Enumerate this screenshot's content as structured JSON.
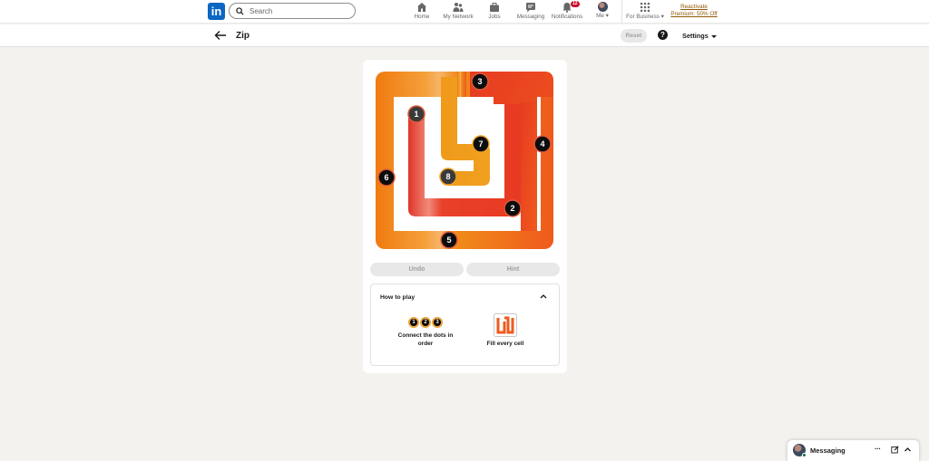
{
  "nav": {
    "logo": "in",
    "search_placeholder": "Search",
    "items": [
      {
        "label": "Home",
        "icon": "home-icon"
      },
      {
        "label": "My Network",
        "icon": "network-icon"
      },
      {
        "label": "Jobs",
        "icon": "briefcase-icon"
      },
      {
        "label": "Messaging",
        "icon": "chat-icon"
      },
      {
        "label": "Notifications",
        "icon": "bell-icon",
        "badge": "12"
      },
      {
        "label": "Me",
        "icon": "avatar"
      },
      {
        "label": "For Business",
        "icon": "grid-icon"
      }
    ],
    "premium": "Reactivate Premium: 50% Off"
  },
  "game": {
    "title": "Zip",
    "reset_label": "Reset",
    "help_label": "?",
    "settings_label": "Settings",
    "numbers": [
      "1",
      "2",
      "3",
      "4",
      "5",
      "6",
      "7",
      "8"
    ],
    "undo_label": "Undo",
    "hint_label": "Hint",
    "colors": {
      "path_light": "#f59e0b",
      "path_mid": "#ea580c",
      "path_dark": "#dc2626"
    }
  },
  "howto": {
    "title": "How to play",
    "step1_dots": [
      "1",
      "2",
      "3"
    ],
    "step1_text": "Connect the dots in order",
    "step2_text": "Fill every cell"
  },
  "messaging": {
    "label": "Messaging",
    "more": "···"
  }
}
